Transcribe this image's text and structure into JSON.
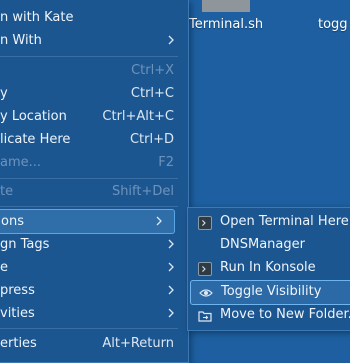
{
  "desktop": {
    "files": [
      "Terminal.sh",
      "togg"
    ]
  },
  "context_menu": {
    "items": [
      {
        "label": "n with Kate",
        "shortcut": ""
      },
      {
        "label": "n With",
        "shortcut": ""
      },
      {
        "label": "",
        "shortcut": "Ctrl+X"
      },
      {
        "label": "y",
        "shortcut": "Ctrl+C"
      },
      {
        "label": "y Location",
        "shortcut": "Ctrl+Alt+C"
      },
      {
        "label": "licate Here",
        "shortcut": "Ctrl+D"
      },
      {
        "label": "ame...",
        "shortcut": "F2"
      },
      {
        "label": "te",
        "shortcut": "Shift+Del"
      },
      {
        "label": "ons",
        "shortcut": ""
      },
      {
        "label": "gn Tags",
        "shortcut": ""
      },
      {
        "label": "e",
        "shortcut": ""
      },
      {
        "label": "press",
        "shortcut": ""
      },
      {
        "label": "vities",
        "shortcut": ""
      },
      {
        "label": "erties",
        "shortcut": "Alt+Return"
      }
    ]
  },
  "actions_submenu": {
    "items": [
      {
        "label": "Open Terminal Here",
        "icon": "terminal-icon"
      },
      {
        "label": "DNSManager",
        "icon": ""
      },
      {
        "label": "Run In Konsole",
        "icon": "terminal-icon"
      },
      {
        "label": "Toggle Visibility",
        "icon": "eye-icon"
      },
      {
        "label": "Move to New Folder...",
        "icon": "folder-move-icon"
      }
    ]
  }
}
